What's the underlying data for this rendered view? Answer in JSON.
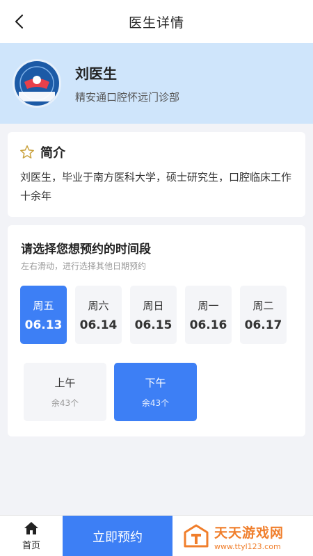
{
  "header": {
    "title": "医生详情"
  },
  "doctor": {
    "name": "刘医生",
    "clinic": "精安通口腔怀远门诊部",
    "avatar_logo_text": "精安通"
  },
  "intro": {
    "title": "简介",
    "text": "刘医生，毕业于南方医科大学，硕士研究生，口腔临床工作十余年"
  },
  "schedule": {
    "title": "请选择您想预约的时间段",
    "hint": "左右滑动，进行选择其他日期预约",
    "dates": [
      {
        "week": "周五",
        "day": "06.13",
        "selected": true
      },
      {
        "week": "周六",
        "day": "06.14",
        "selected": false
      },
      {
        "week": "周日",
        "day": "06.15",
        "selected": false
      },
      {
        "week": "周一",
        "day": "06.16",
        "selected": false
      },
      {
        "week": "周二",
        "day": "06.17",
        "selected": false
      }
    ],
    "slots": [
      {
        "label": "上午",
        "count": "余43个",
        "selected": false
      },
      {
        "label": "下午",
        "count": "余43个",
        "selected": true
      }
    ]
  },
  "bottom": {
    "home_label": "首页",
    "book_label": "立即预约",
    "watermark_title": "天天游戏网",
    "watermark_url": "www.ttyl123.com"
  },
  "colors": {
    "accent": "#3d7ff5",
    "banner_bg": "#cfe5fb",
    "watermark": "#f07e2b",
    "star_outline": "#c9a13b"
  },
  "icons": {
    "back": "chevron-left-icon",
    "intro": "star-outline-icon",
    "home": "home-icon"
  }
}
